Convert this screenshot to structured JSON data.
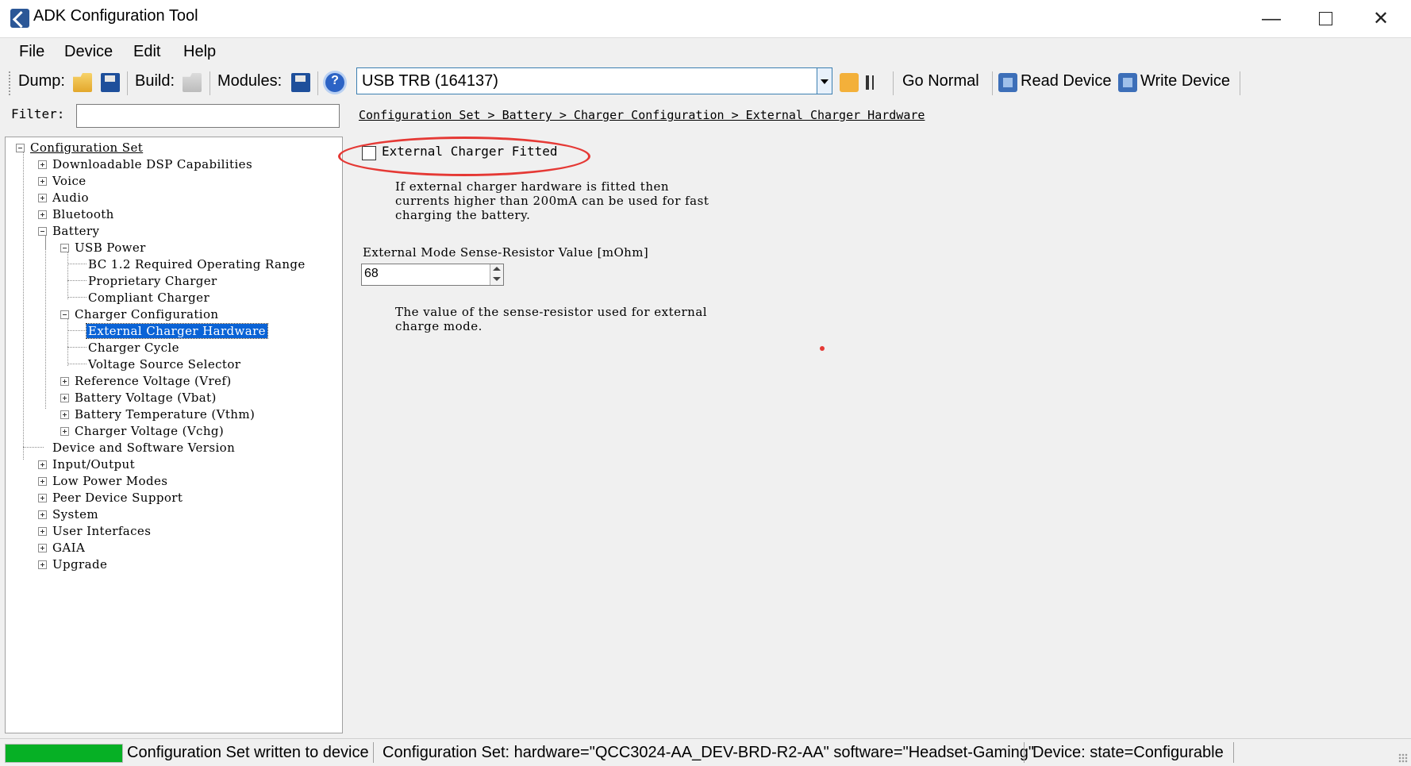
{
  "window": {
    "title": "ADK Configuration Tool"
  },
  "menu": [
    "File",
    "Device",
    "Edit",
    "Help"
  ],
  "toolbar": {
    "dump_label": "Dump:",
    "build_label": "Build:",
    "modules_label": "Modules:",
    "device_selected": "USB TRB (164137)",
    "go_normal": "Go Normal",
    "read_device": "Read Device",
    "write_device": "Write Device"
  },
  "filter": {
    "label": "Filter:",
    "value": ""
  },
  "tree": [
    "Configuration Set",
    "Downloadable DSP Capabilities",
    "Voice",
    "Audio",
    "Bluetooth",
    "Battery",
    "USB Power",
    "BC 1.2 Required Operating Range",
    "Proprietary Charger",
    "Compliant Charger",
    "Charger Configuration",
    "External Charger Hardware",
    "Charger Cycle",
    "Voltage Source Selector",
    "Reference Voltage (Vref)",
    "Battery Voltage (Vbat)",
    "Battery Temperature (Vthm)",
    "Charger Voltage (Vchg)",
    "Device and Software Version",
    "Input/Output",
    "Low Power Modes",
    "Peer Device Support",
    "System",
    "User Interfaces",
    "GAIA",
    "Upgrade"
  ],
  "selected_node": "External Charger Hardware",
  "breadcrumb": "Configuration Set > Battery > Charger Configuration > External Charger Hardware",
  "settings": {
    "external_charger_label": "External Charger Fitted",
    "external_charger_checked": false,
    "external_charger_desc": [
      "If external charger hardware is fitted then",
      "currents higher than 200mA can be used for fast",
      "charging the battery."
    ],
    "sense_label": "External Mode Sense-Resistor Value [mOhm]",
    "sense_value": "68",
    "sense_desc": [
      "The value of the sense-resistor used for external",
      "charge mode."
    ]
  },
  "status": {
    "progress_percent": 100,
    "message": "Configuration Set written to device",
    "config_set": "Configuration Set:  hardware=\"QCC3024-AA_DEV-BRD-R2-AA\" software=\"Headset-Gaming\"",
    "device_state": "Device:  state=Configurable"
  },
  "colors": {
    "selection": "#0a63d6",
    "progress": "#06b025",
    "annotation": "#e53935"
  }
}
